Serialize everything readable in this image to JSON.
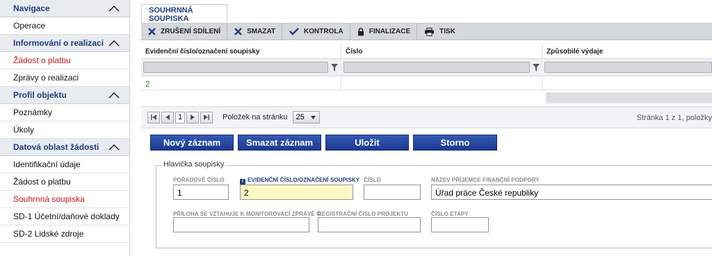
{
  "sidebar": {
    "sections": [
      {
        "title": "Navigace",
        "items": [
          "Operace"
        ]
      },
      {
        "title": "Informování o realizaci",
        "items": [
          "Žádost o platbu",
          "Zprávy o realizaci"
        ]
      },
      {
        "title": "Profil objektu",
        "items": [
          "Poznámky",
          "Úkoly"
        ]
      },
      {
        "title": "Datová oblast žádosti",
        "items": [
          "Identifikační údaje",
          "Žádost o platbu",
          "Souhrnná soupiska",
          "SD-1 Účetní/daňové doklady",
          "SD-2 Lidské zdroje"
        ]
      }
    ]
  },
  "tab": {
    "label": "SOUHRNNÁ SOUPISKA"
  },
  "toolbar": {
    "zruseni": "ZRUŠENÍ SDÍLENÍ",
    "smazat": "SMAZAT",
    "kontrola": "KONTROLA",
    "finalizace": "FINALIZACE",
    "tisk": "TISK"
  },
  "grid": {
    "columns": [
      "Evidenční číslo/označení soupisky",
      "Číslo",
      "Způsobilé výdaje"
    ],
    "rows": [
      [
        "2",
        "",
        ""
      ]
    ]
  },
  "pager": {
    "current_page": "1",
    "per_page_label": "Položek na stránku",
    "per_page_value": "25",
    "info": "Stránka 1 z 1, položky"
  },
  "actions": {
    "new": "Nový záznam",
    "delete": "Smazat záznam",
    "save": "Uložit",
    "cancel": "Storno"
  },
  "form": {
    "legend": "Hlavička soupisky",
    "poradove_label": "POŘADOVÉ ČÍSLO",
    "poradove_value": "1",
    "evid_label": "EVIDENČNÍ ČÍSLO/OZNAČENÍ SOUPISKY",
    "evid_value": "2",
    "cislo_label": "ČÍSLO",
    "cislo_value": "",
    "nazev_label": "NÁZEV PŘÍJEMCE FINANČNÍ PODPORY",
    "nazev_value": "Úřad práce České republiky",
    "priloha_label": "PŘÍLOHA SE VZTAHUJE K MONITOROVACÍ ZPRÁVĚ Č.",
    "priloha_value": "",
    "registracni_label": "REGISTRAČNÍ ČÍSLO PROJEKTU",
    "registracni_value": "",
    "etapa_label": "ČÍSLO ETAPY",
    "etapa_value": ""
  },
  "colors": {
    "accent": "#1e3c7b",
    "link_red": "#c4161c",
    "button_blue": "#2a4aa0",
    "highlight": "#fdf9c5"
  }
}
